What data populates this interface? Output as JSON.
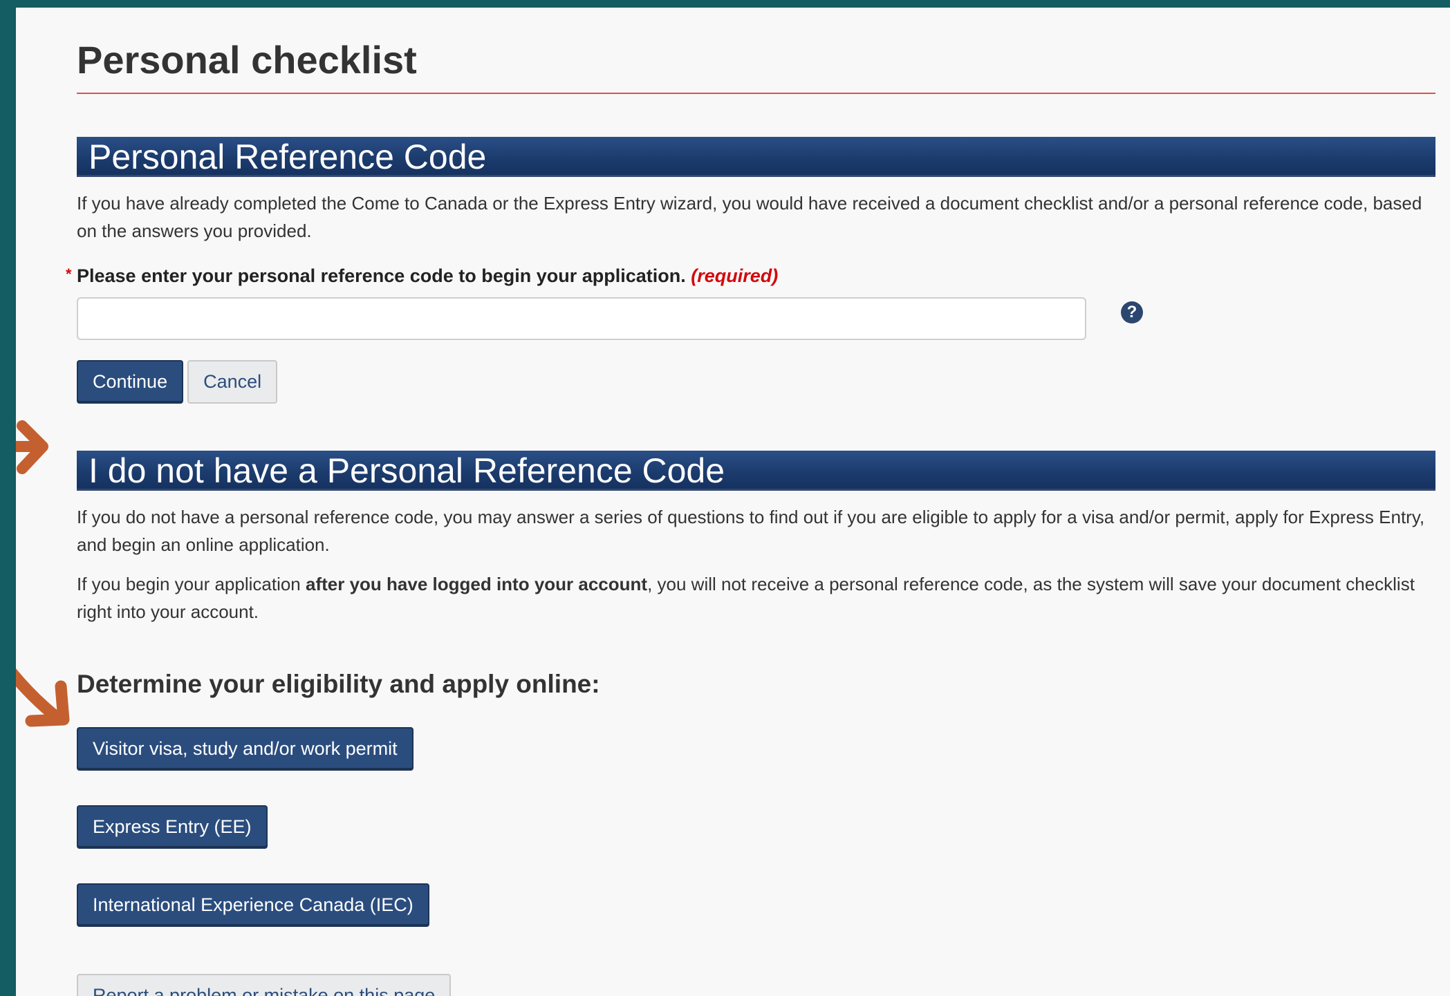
{
  "page": {
    "title": "Personal checklist"
  },
  "reference_section": {
    "heading": "Personal Reference Code",
    "intro": "If you have already completed the Come to Canada or the Express Entry wizard, you would have received a document checklist and/or a personal reference code, based on the answers you provided.",
    "field_label": "Please enter your personal reference code to begin your application.",
    "required_tag": "(required)",
    "required_marker": "*",
    "input_value": "",
    "help_icon": "question-circle-icon",
    "continue_label": "Continue",
    "cancel_label": "Cancel"
  },
  "no_code_section": {
    "heading": "I do not have a Personal Reference Code",
    "para1": "If you do not have a personal reference code, you may answer a series of questions to find out if you are eligible to apply for a visa and/or permit, apply for Express Entry, and begin an online application.",
    "para2_start": "If you begin your application ",
    "para2_bold": "after you have logged into your account",
    "para2_end": ", you will not receive a personal reference code, as the system will save your document checklist right into your account.",
    "eligibility_heading": "Determine your eligibility and apply online:",
    "buttons": [
      {
        "label": "Visitor visa, study and/or work permit"
      },
      {
        "label": "Express Entry (EE)"
      },
      {
        "label": "International Experience Canada (IEC)"
      }
    ]
  },
  "footer": {
    "report_label": "Report a problem or mistake on this page"
  },
  "colors": {
    "frame": "#135d63",
    "banner": "#1c3c6e",
    "button": "#2b4d7e",
    "required": "#d3080c",
    "arrow": "#c4602f"
  }
}
